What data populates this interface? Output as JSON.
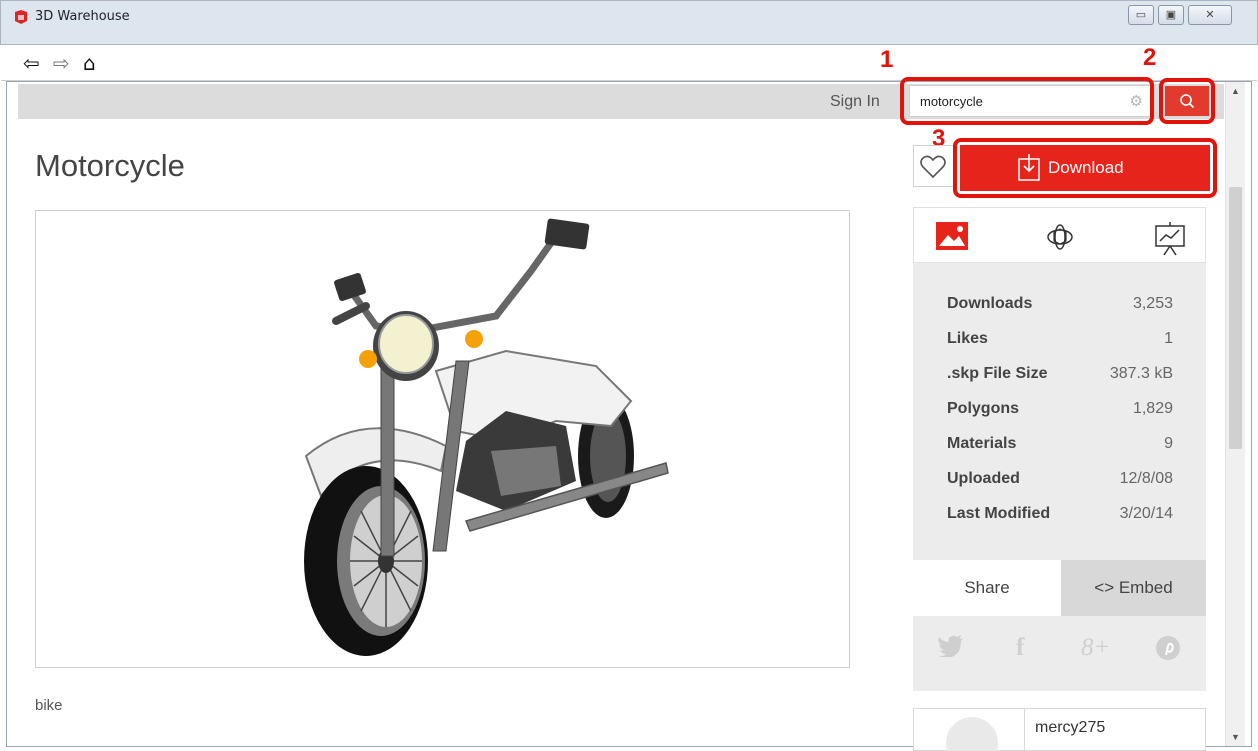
{
  "window": {
    "title": "3D Warehouse",
    "minimize_icon": "minimize-icon",
    "restore_icon": "restore-icon",
    "close_icon": "close-icon"
  },
  "nav": {
    "back_icon": "back-arrow-icon",
    "forward_icon": "forward-arrow-icon",
    "home_icon": "home-icon"
  },
  "header": {
    "sign_in": "Sign In",
    "search_value": "motorcycle",
    "search_settings_icon": "gear-icon",
    "search_button_icon": "search-icon"
  },
  "annotations": [
    "1",
    "2",
    "3"
  ],
  "annotation_color": "#e3120b",
  "model": {
    "title": "Motorcycle",
    "tag": "bike"
  },
  "actions": {
    "like_icon": "heart-icon",
    "download_label": "Download",
    "download_color": "#e7241b"
  },
  "view_tabs": [
    "image-view-icon",
    "3d-view-icon",
    "presentation-icon"
  ],
  "stats": [
    {
      "label": "Downloads",
      "value": "3,253"
    },
    {
      "label": "Likes",
      "value": "1"
    },
    {
      "label": ".skp File Size",
      "value": "387.3 kB"
    },
    {
      "label": "Polygons",
      "value": "1,829"
    },
    {
      "label": "Materials",
      "value": "9"
    },
    {
      "label": "Uploaded",
      "value": "12/8/08"
    },
    {
      "label": "Last Modified",
      "value": "3/20/14"
    }
  ],
  "share": {
    "share_label": "Share",
    "embed_label": "<> Embed",
    "social": [
      {
        "icon": "twitter-icon",
        "glyph": "🐦"
      },
      {
        "icon": "facebook-icon",
        "glyph": "f"
      },
      {
        "icon": "google-plus-icon",
        "glyph": "8+"
      },
      {
        "icon": "pinterest-icon",
        "glyph": "℗"
      }
    ]
  },
  "author": {
    "name": "mercy275"
  }
}
